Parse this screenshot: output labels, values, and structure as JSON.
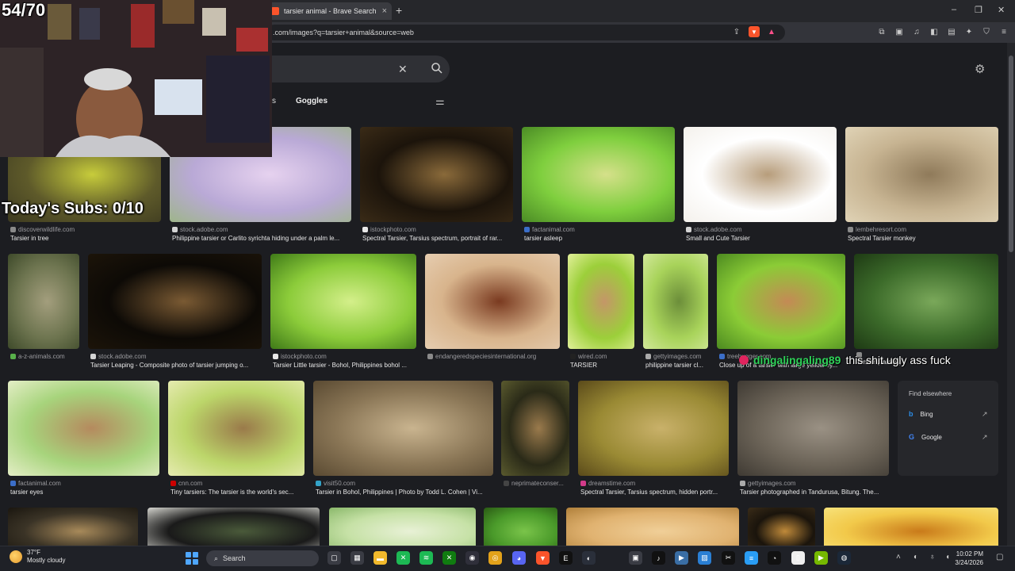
{
  "overlay": {
    "counter": "54/70",
    "subs": "Today's Subs: 0/10",
    "chat_user": "dingalingaling89",
    "chat_message": "this shit ugly ass fuck"
  },
  "browser": {
    "tab_title": "tarsier animal - Brave Search",
    "tab_close": "×",
    "new_tab": "+",
    "url": ".com/images?q=tarsier+animal&source=web",
    "window_controls": [
      "–",
      "❐",
      "✕"
    ]
  },
  "search": {
    "nav_partial": "s",
    "nav_goggles": "Goggles"
  },
  "results": [
    {
      "source": "discoverwildlife.com",
      "caption": "Tarsier in tree",
      "fav": "#8a8a8a",
      "colors": [
        "#5e5a2a",
        "#c7cc3b",
        "#3d3a20"
      ]
    },
    {
      "source": "stock.adobe.com",
      "caption": "Philippine tarsier or Carlito syrichta hiding under a palm le...",
      "fav": "#d4d4d4",
      "colors": [
        "#b9a9d6",
        "#e6d2ef",
        "#9eb58a"
      ]
    },
    {
      "source": "istockphoto.com",
      "caption": "Spectral Tarsier, Tarsius spectrum, portrait of rar...",
      "fav": "#e8e8e8",
      "colors": [
        "#1c140b",
        "#8a6a3a",
        "#3a2b17"
      ]
    },
    {
      "source": "factanimal.com",
      "caption": "tarsier asleep",
      "fav": "#3b6ec8",
      "colors": [
        "#7fcf3e",
        "#d5e08a",
        "#4b8c25"
      ]
    },
    {
      "source": "stock.adobe.com",
      "caption": "Small and Cute Tarsier",
      "fav": "#d4d4d4",
      "colors": [
        "#ffffff",
        "#b79d7b",
        "#f4f1ec"
      ]
    },
    {
      "source": "lembehresort.com",
      "caption": "Spectral Tarsier monkey",
      "fav": "#8a8a8a",
      "colors": [
        "#c7b492",
        "#8f7a5a",
        "#e0d3b6"
      ]
    },
    {
      "source": "a-z-animals.com",
      "caption": "",
      "fav": "#58b04a",
      "colors": [
        "#6e7550",
        "#a39e7d",
        "#3e4a2a"
      ]
    },
    {
      "source": "stock.adobe.com",
      "caption": "Tarsier Leaping - Composite photo of tarsier jumping o...",
      "fav": "#d4d4d4",
      "colors": [
        "#0d0a06",
        "#7a5a33",
        "#1c1409"
      ]
    },
    {
      "source": "istockphoto.com",
      "caption": "Tarsier Little tarsier - Bohol, Philippines bohol ...",
      "fav": "#e8e8e8",
      "colors": [
        "#8ccc3a",
        "#d4ef8a",
        "#3f7a18"
      ]
    },
    {
      "source": "endangeredspeciesinternational.org",
      "caption": "",
      "fav": "#8a8a8a",
      "colors": [
        "#d8b48c",
        "#7a3a20",
        "#e6cdb0"
      ]
    },
    {
      "source": "wired.com",
      "caption": "TARSIER",
      "fav": "#222222",
      "colors": [
        "#9ccf3a",
        "#c49668",
        "#e2f09a"
      ]
    },
    {
      "source": "gettyimages.com",
      "caption": "philippine tarsier cl...",
      "fav": "#aaaaaa",
      "colors": [
        "#a8d35a",
        "#6c8e3a",
        "#d2e89a"
      ]
    },
    {
      "source": "treehugger.com",
      "caption": "Close up of a tarsier with large yellow ey...",
      "fav": "#3b6ec8",
      "colors": [
        "#8bcc36",
        "#c48a55",
        "#4c8a20"
      ]
    },
    {
      "source": "",
      "caption": "Tarsier (Tarsius)",
      "fav": "#8a8a8a",
      "colors": [
        "#3c6b2a",
        "#7aa85a",
        "#1e3a14"
      ]
    },
    {
      "source": "factanimal.com",
      "caption": "tarsier eyes",
      "fav": "#3b6ec8",
      "colors": [
        "#a7d47c",
        "#b58a5e",
        "#e4eec6"
      ]
    },
    {
      "source": "cnn.com",
      "caption": "Tiny tarsiers: The tarsier is the world's sec...",
      "fav": "#cc0000",
      "colors": [
        "#bcd66a",
        "#9a7a4a",
        "#e6ebb0"
      ]
    },
    {
      "source": "visit50.com",
      "caption": "Tarsier in Bohol, Philippines | Photo by Todd L. Cohen | Vi...",
      "fav": "#33a3c8",
      "colors": [
        "#8a7656",
        "#c9b48f",
        "#5a4a32"
      ]
    },
    {
      "source": "neprimateconser...",
      "caption": "",
      "fav": "#444444",
      "colors": [
        "#2a2a18",
        "#9a7a4c",
        "#5a5a2e"
      ]
    },
    {
      "source": "dreamstime.com",
      "caption": "Spectral Tarsier, Tarsius spectrum, hidden portr...",
      "fav": "#d23a8a",
      "colors": [
        "#9a8a34",
        "#c9b16a",
        "#5a4a1a"
      ]
    },
    {
      "source": "gettyimages.com",
      "caption": "Tarsier photographed in Tandurusa, Bitung. The...",
      "fav": "#aaaaaa",
      "colors": [
        "#6b6357",
        "#9a9184",
        "#3f3a33"
      ]
    },
    {
      "source": "",
      "caption": "",
      "fav": "",
      "colors": [
        "#3a3326",
        "#a88a5a",
        "#1a160f"
      ]
    },
    {
      "source": "",
      "caption": "",
      "fav": "",
      "colors": [
        "#1a1a1a",
        "#4a5a3a",
        "#d6d6d0"
      ]
    },
    {
      "source": "",
      "caption": "",
      "fav": "",
      "colors": [
        "#c6e1a6",
        "#e8f1d6",
        "#8ab86a"
      ]
    },
    {
      "source": "",
      "caption": "",
      "fav": "",
      "colors": [
        "#4a9a2a",
        "#7ac44a",
        "#2a5a14"
      ]
    },
    {
      "source": "",
      "caption": "",
      "fav": "",
      "colors": [
        "#e0b270",
        "#f0cf98",
        "#b0803a"
      ]
    },
    {
      "source": "",
      "caption": "",
      "fav": "",
      "colors": [
        "#1a140c",
        "#c08a3a",
        "#3a2c18"
      ]
    },
    {
      "source": "",
      "caption": "",
      "fav": "",
      "colors": [
        "#f2c94a",
        "#c97a1a",
        "#f7e27a"
      ]
    }
  ],
  "find_elsewhere": {
    "title": "Find elsewhere",
    "engines": [
      {
        "name": "Bing",
        "icon": "bing-icon",
        "color": "#2b8ce6"
      },
      {
        "name": "Google",
        "icon": "google-icon",
        "color": "#4285f4"
      }
    ]
  },
  "taskbar": {
    "temperature": "37°F",
    "weather": "Mostly cloudy",
    "search_placeholder": "Search",
    "time": "10:02 PM",
    "date": "3/24/2026",
    "apps": [
      {
        "name": "task-view-icon",
        "glyph": "▢",
        "color": "#3a3c44"
      },
      {
        "name": "widgets-icon",
        "glyph": "▦",
        "color": "#3a3c44"
      },
      {
        "name": "file-explorer-icon",
        "glyph": "▬",
        "color": "#f2b92c"
      },
      {
        "name": "xbox-app-icon",
        "glyph": "✕",
        "color": "#1db954"
      },
      {
        "name": "spotify-icon",
        "glyph": "≋",
        "color": "#1db954"
      },
      {
        "name": "xbox-icon",
        "glyph": "✕",
        "color": "#107c10"
      },
      {
        "name": "obs-icon",
        "glyph": "◉",
        "color": "#2f2f3a"
      },
      {
        "name": "chrome-icon",
        "glyph": "◎",
        "color": "#e3a21a"
      },
      {
        "name": "discord-icon",
        "glyph": "◕",
        "color": "#5865f2"
      },
      {
        "name": "brave-icon",
        "glyph": "▼",
        "color": "#fb542b"
      },
      {
        "name": "epic-games-icon",
        "glyph": "E",
        "color": "#111111"
      },
      {
        "name": "steam-alt-icon",
        "glyph": "◐",
        "color": "#2a2f3a"
      },
      {
        "name": "camera-icon",
        "glyph": "▣",
        "color": "#3a3c44"
      },
      {
        "name": "tiktok-icon",
        "glyph": "♪",
        "color": "#111111"
      },
      {
        "name": "media-icon",
        "glyph": "▶",
        "color": "#3a6ea5"
      },
      {
        "name": "photos-icon",
        "glyph": "▨",
        "color": "#2a7fd4"
      },
      {
        "name": "capcut-icon",
        "glyph": "✂",
        "color": "#111111"
      },
      {
        "name": "notepad-icon",
        "glyph": "≡",
        "color": "#2a9df4"
      },
      {
        "name": "gauge-icon",
        "glyph": "◔",
        "color": "#111111"
      },
      {
        "name": "document-icon",
        "glyph": "▯",
        "color": "#eeeeee"
      },
      {
        "name": "nvidia-icon",
        "glyph": "▶",
        "color": "#76b900"
      },
      {
        "name": "steam-icon",
        "glyph": "◍",
        "color": "#1b2838"
      }
    ]
  }
}
